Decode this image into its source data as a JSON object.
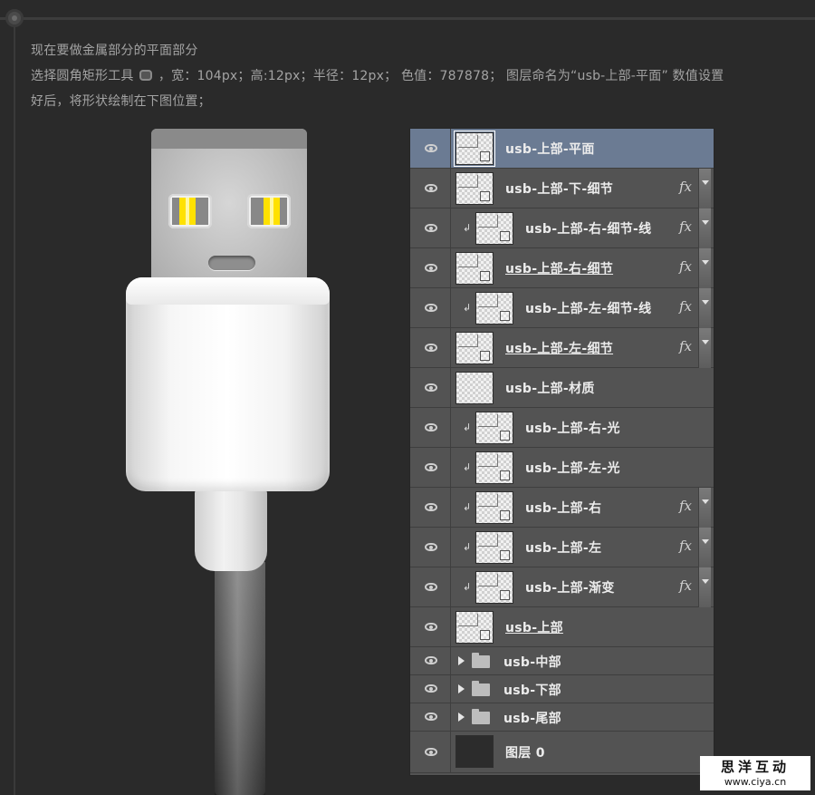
{
  "instructions": {
    "line1": "现在要做金属部分的平面部分",
    "line2_prefix": "选择圆角矩形工具",
    "line2_suffix": "，宽：104px；高:12px；半径：12px；  色值：787878；  图层命名为“usb-上部-平面”  数值设置",
    "line3": "好后，将形状绘制在下图位置；"
  },
  "colors": {
    "background": "#2a2a2a",
    "panel": "#535353",
    "selected_layer": "#6b7b93",
    "contact_yellow": "#ffe100",
    "contact_gray": "#888888"
  },
  "layers_panel": {
    "layers": [
      {
        "name": "usb-上部-平面",
        "selected": true,
        "clipped": false,
        "fx": false,
        "underline": false,
        "type": "shape"
      },
      {
        "name": "usb-上部-下-细节",
        "selected": false,
        "clipped": false,
        "fx": true,
        "underline": false,
        "type": "shape"
      },
      {
        "name": "usb-上部-右-细节-线",
        "selected": false,
        "clipped": true,
        "fx": true,
        "underline": false,
        "type": "shape"
      },
      {
        "name": "usb-上部-右-细节",
        "selected": false,
        "clipped": false,
        "fx": true,
        "underline": true,
        "type": "shape"
      },
      {
        "name": "usb-上部-左-细节-线",
        "selected": false,
        "clipped": true,
        "fx": true,
        "underline": false,
        "type": "shape"
      },
      {
        "name": "usb-上部-左-细节",
        "selected": false,
        "clipped": false,
        "fx": true,
        "underline": true,
        "type": "shape"
      },
      {
        "name": "usb-上部-材质",
        "selected": false,
        "clipped": false,
        "fx": false,
        "underline": false,
        "type": "pixel"
      },
      {
        "name": "usb-上部-右-光",
        "selected": false,
        "clipped": true,
        "fx": false,
        "underline": false,
        "type": "shape"
      },
      {
        "name": "usb-上部-左-光",
        "selected": false,
        "clipped": true,
        "fx": false,
        "underline": false,
        "type": "shape"
      },
      {
        "name": "usb-上部-右",
        "selected": false,
        "clipped": true,
        "fx": true,
        "underline": false,
        "type": "shape"
      },
      {
        "name": "usb-上部-左",
        "selected": false,
        "clipped": true,
        "fx": true,
        "underline": false,
        "type": "shape"
      },
      {
        "name": "usb-上部-渐变",
        "selected": false,
        "clipped": true,
        "fx": true,
        "underline": false,
        "type": "shape"
      },
      {
        "name": "usb-上部",
        "selected": false,
        "clipped": false,
        "fx": false,
        "underline": true,
        "type": "shape"
      }
    ],
    "groups": [
      {
        "name": "usb-中部"
      },
      {
        "name": "usb-下部"
      },
      {
        "name": "usb-尾部"
      }
    ],
    "background_layer": {
      "name": "图层 0"
    },
    "fx_label": "fx"
  },
  "watermark": {
    "title": "思洋互动",
    "url": "www.ciya.cn"
  }
}
